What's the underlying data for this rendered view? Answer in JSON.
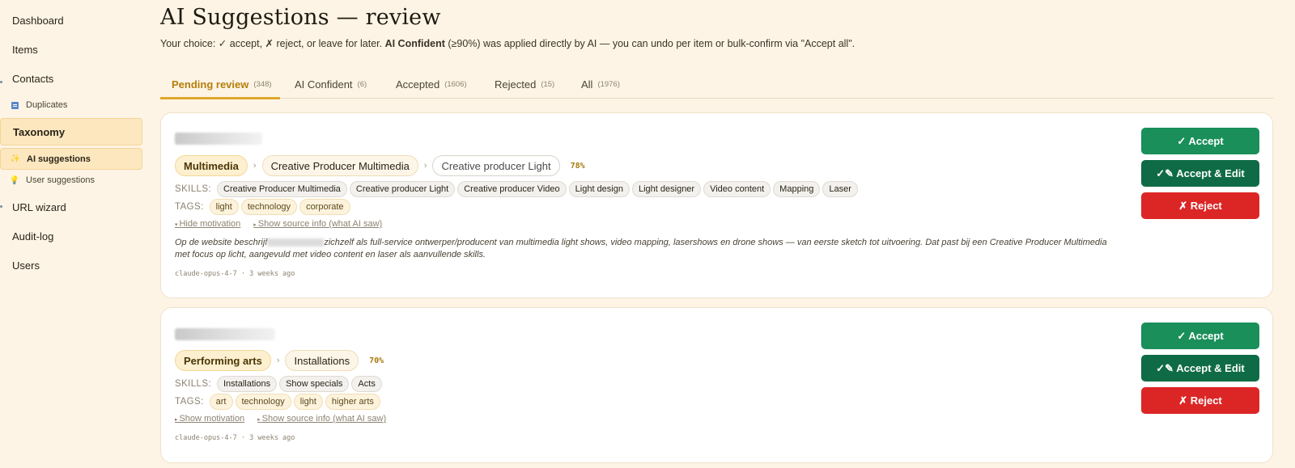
{
  "sidebar": {
    "items": [
      {
        "label": "Dashboard"
      },
      {
        "label": "Items"
      },
      {
        "label": "Contacts"
      },
      {
        "label": "Duplicates"
      },
      {
        "label": "Taxonomy"
      },
      {
        "label": "AI suggestions"
      },
      {
        "label": "User suggestions"
      },
      {
        "label": "URL wizard"
      },
      {
        "label": "Audit-log"
      },
      {
        "label": "Users"
      }
    ]
  },
  "header": {
    "title": "AI Suggestions — review",
    "subtitle_pre": "Your choice: ✓ accept, ✗ reject, or leave for later. ",
    "subtitle_bold": "AI Confident",
    "subtitle_post": " (≥90%) was applied directly by AI — you can undo per item or bulk-confirm via \"Accept all\"."
  },
  "tabs": [
    {
      "label": "Pending review",
      "count": "(348)"
    },
    {
      "label": "AI Confident",
      "count": "(6)"
    },
    {
      "label": "Accepted",
      "count": "(1606)"
    },
    {
      "label": "Rejected",
      "count": "(15)"
    },
    {
      "label": "All",
      "count": "(1976)"
    }
  ],
  "labels": {
    "skills": "SKILLS:",
    "tags": "TAGS:"
  },
  "buttons": {
    "accept": "✓ Accept",
    "accept_edit": "✓✎ Accept & Edit",
    "reject": "✗ Reject"
  },
  "cards": [
    {
      "path": [
        "Multimedia",
        "Creative Producer Multimedia",
        "Creative producer Light"
      ],
      "confidence": "78%",
      "skills": [
        "Creative Producer Multimedia",
        "Creative producer Light",
        "Creative producer Video",
        "Light design",
        "Light designer",
        "Video content",
        "Mapping",
        "Laser"
      ],
      "tags": [
        "light",
        "technology",
        "corporate"
      ],
      "motivation_link": "Hide motivation",
      "source_link": "Show source info (what AI saw)",
      "motivation_pre": "Op de website beschrijf",
      "motivation_post": "zichzelf als full-service ontwerper/producent van multimedia light shows, video mapping, lasershows en drone shows — van eerste sketch tot uitvoering. Dat past bij een Creative Producer Multimedia met focus op licht, aangevuld met video content en laser als aanvullende skills.",
      "meta": "claude-opus-4-7 · 3 weeks ago"
    },
    {
      "path": [
        "Performing arts",
        "Installations"
      ],
      "confidence": "70%",
      "skills": [
        "Installations",
        "Show specials",
        "Acts"
      ],
      "tags": [
        "art",
        "technology",
        "light",
        "higher arts"
      ],
      "motivation_link": "Show motivation",
      "source_link": "Show source info (what AI saw)",
      "meta": "claude-opus-4-7 · 3 weeks ago"
    }
  ],
  "colors": {
    "accent": "#e0a72b",
    "accept": "#1a8f5a",
    "accept_edit": "#0f6b45",
    "reject": "#dc2626",
    "background": "#fdf4e6"
  }
}
